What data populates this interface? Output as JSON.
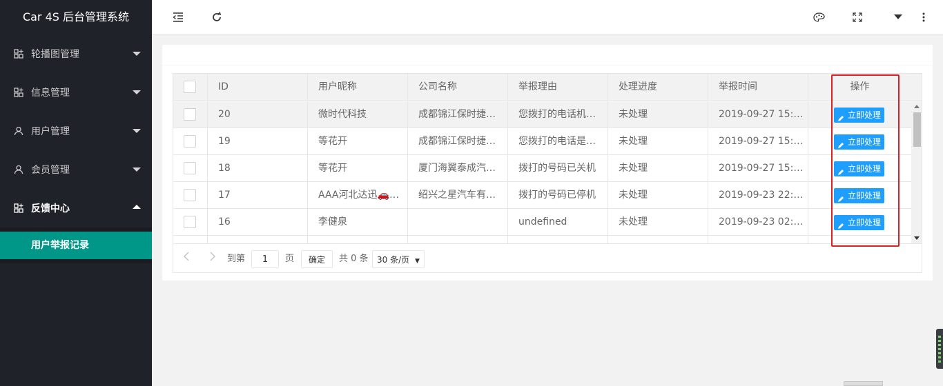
{
  "app": {
    "title": "Car 4S 后台管理系统"
  },
  "sidebar": {
    "items": [
      {
        "label": "轮播图管理",
        "icon": "grid-icon",
        "open": false
      },
      {
        "label": "信息管理",
        "icon": "grid-icon",
        "open": false
      },
      {
        "label": "用户管理",
        "icon": "user-icon",
        "open": false
      },
      {
        "label": "会员管理",
        "icon": "user-icon",
        "open": false
      },
      {
        "label": "反馈中心",
        "icon": "grid-icon",
        "open": true
      }
    ],
    "submenu": {
      "label": "用户举报记录",
      "active": true
    },
    "accent_color": "#009688",
    "bg_color": "#20222a"
  },
  "header": {
    "left_icons": [
      "menu-fold-icon",
      "refresh-icon"
    ],
    "right_icons": [
      "theme-palette-icon",
      "fullscreen-icon",
      "dropdown-caret-icon",
      "more-vertical-icon"
    ]
  },
  "table": {
    "columns": [
      "",
      "ID",
      "用户昵称",
      "公司名称",
      "举报理由",
      "处理进度",
      "举报时间",
      "操作"
    ],
    "rows": [
      {
        "id": "20",
        "nickname": "微时代科技",
        "company": "成都锦江保时捷…",
        "reason": "您拨打的电话机…",
        "status": "未处理",
        "time": "2019-09-27 15:…",
        "action": "立即处理",
        "highlighted": true
      },
      {
        "id": "19",
        "nickname": "等花开",
        "company": "成都锦江保时捷…",
        "reason": "您拨打的电话是…",
        "status": "未处理",
        "time": "2019-09-27 15:…",
        "action": "立即处理",
        "highlighted": false
      },
      {
        "id": "18",
        "nickname": "等花开",
        "company": "厦门海翼泰成汽…",
        "reason": "拨打的号码已关机",
        "status": "未处理",
        "time": "2019-09-27 15:…",
        "action": "立即处理",
        "highlighted": false
      },
      {
        "id": "17",
        "nickname": "AAA河北达迅🚗…",
        "company": "绍兴之星汽车有…",
        "reason": "拨打的号码已停机",
        "status": "未处理",
        "time": "2019-09-23 22:…",
        "action": "立即处理",
        "highlighted": false
      },
      {
        "id": "16",
        "nickname": "李健泉",
        "company": "",
        "reason": "undefined",
        "status": "未处理",
        "time": "2019-09-23 02:…",
        "action": "立即处理",
        "highlighted": false
      }
    ],
    "action_color": "#1e9fff"
  },
  "pager": {
    "goto_label": "到第",
    "page_value": "1",
    "page_unit": "页",
    "confirm_label": "确定",
    "total_label": "共 0 条",
    "page_size": "30 条/页"
  }
}
